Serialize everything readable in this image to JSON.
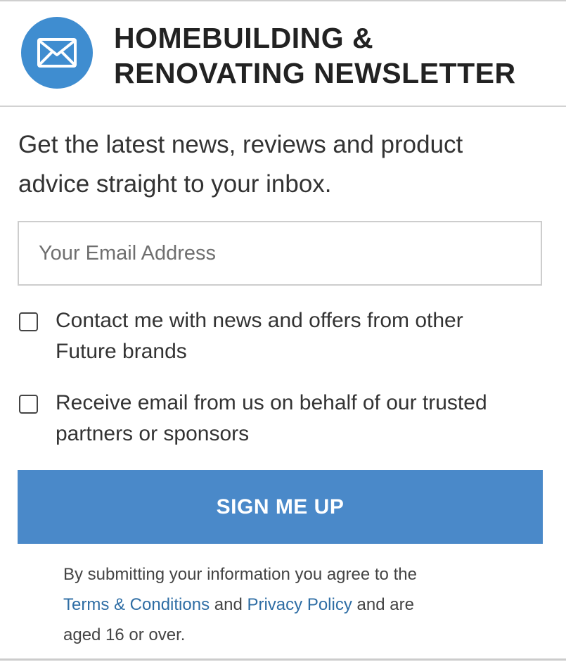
{
  "header": {
    "icon": "envelope-icon",
    "title_line1": "HOMEBUILDING &",
    "title_line2": "RENOVATING NEWSLETTER"
  },
  "intro": {
    "line1": "Get the latest news, reviews and product",
    "line2": "advice straight to your inbox."
  },
  "email_field": {
    "value": "",
    "placeholder": "Your Email Address"
  },
  "consents": [
    {
      "checked": false,
      "line1": "Contact me with news and offers from other",
      "line2": "Future brands"
    },
    {
      "checked": false,
      "line1": "Receive email from us on behalf of our trusted",
      "line2": "partners or sponsors"
    }
  ],
  "signup": {
    "label": "SIGN ME UP"
  },
  "legal": {
    "line1": "By submitting your information you agree to the",
    "terms_link": "Terms & Conditions",
    "and_text": "and",
    "privacy_link": "Privacy Policy",
    "tail": "and are",
    "line3": "aged 16 or over."
  },
  "colors": {
    "accent": "#4a89c9",
    "badge": "#3f8dd0",
    "link": "#2e6da4",
    "text": "#333333",
    "rule": "#d2d2d2"
  }
}
